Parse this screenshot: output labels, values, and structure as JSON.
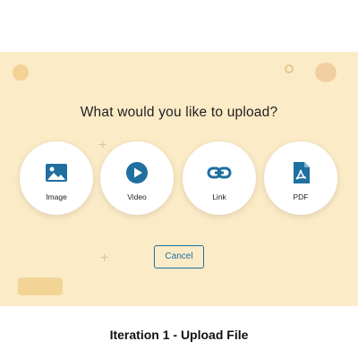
{
  "dialog": {
    "title": "What would you like to upload?",
    "options": [
      {
        "label": "Image",
        "icon": "image-icon"
      },
      {
        "label": "Video",
        "icon": "play-icon"
      },
      {
        "label": "Link",
        "icon": "link-icon"
      },
      {
        "label": "PDF",
        "icon": "pdf-icon"
      }
    ],
    "cancel_label": "Cancel"
  },
  "caption": "Iteration 1 - Upload File",
  "colors": {
    "overlay_background": "#fcebc7",
    "icon_blue": "#1f6fa0",
    "card_white": "#ffffff",
    "text_dark": "#1f1f1f"
  }
}
